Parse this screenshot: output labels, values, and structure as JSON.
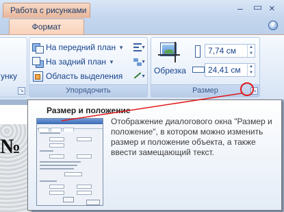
{
  "window": {
    "contextual_tab_group": "Работа с рисунками",
    "controls": {
      "minimize": "–",
      "maximize": "▭",
      "close": "×"
    }
  },
  "ribbon": {
    "active_tab": "Формат",
    "groups": [
      {
        "id": "left-clipped",
        "items": [
          {
            "label": "унку"
          }
        ],
        "label": ""
      },
      {
        "id": "arrange",
        "label": "Упорядочить",
        "items": [
          {
            "label": "На передний план",
            "icon": "bring-front-icon",
            "has_dropdown": true
          },
          {
            "label": "На задний план",
            "icon": "send-back-icon",
            "has_dropdown": true
          },
          {
            "label": "Область выделения",
            "icon": "selection-pane-icon",
            "has_dropdown": false
          }
        ]
      },
      {
        "id": "size",
        "label": "Размер",
        "crop_label": "Обрезка",
        "height_value": "7,74 см",
        "width_value": "24,41 см"
      }
    ]
  },
  "tooltip": {
    "title": "Размер и положение",
    "body": "Отображение диалогового окна \"Размер и положение\", в котором можно изменить размер и положение объекта, а также ввести замещающий текст."
  },
  "document": {
    "visible_text": "№"
  },
  "colors": {
    "ribbon_text": "#15428b",
    "context_tab": "#f9d2bc",
    "highlight": "#e01a1a"
  }
}
